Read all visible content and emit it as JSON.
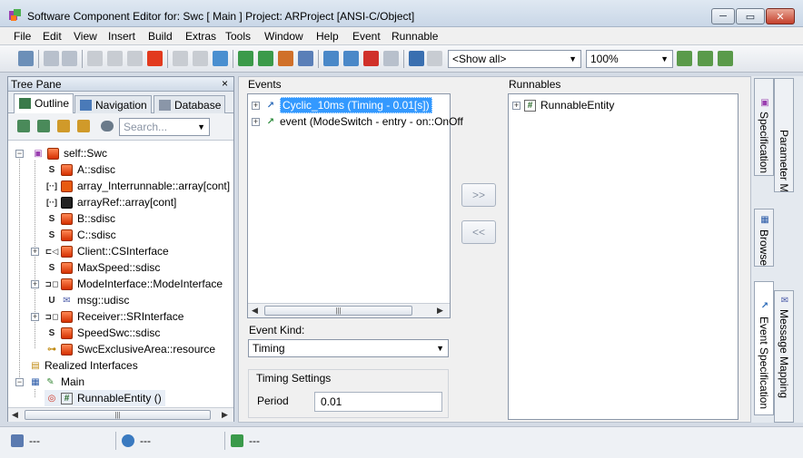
{
  "window": {
    "title": "Software Component Editor for: Swc [ Main ] Project: ARProject [ANSI-C/Object]",
    "min": "─",
    "max": "▭",
    "close": "✕"
  },
  "menu": [
    "File",
    "Edit",
    "View",
    "Insert",
    "Build",
    "Extras",
    "Tools",
    "Window",
    "Help",
    "Event",
    "Runnable"
  ],
  "toolbar": {
    "filter_combo": "<Show all>",
    "zoom_combo": "100%"
  },
  "tree_pane": {
    "title": "Tree Pane",
    "close": "×",
    "tabs": [
      "Outline",
      "Navigation",
      "Database"
    ],
    "search_placeholder": "Search...",
    "nodes": [
      {
        "label": "self::Swc",
        "glyph": "▣"
      },
      {
        "label": "A::sdisc",
        "glyph": "S"
      },
      {
        "label": "array_Interrunnable::array[cont]",
        "glyph": "[··]"
      },
      {
        "label": "arrayRef::array[cont]",
        "glyph": "[··]"
      },
      {
        "label": "B::sdisc",
        "glyph": "S"
      },
      {
        "label": "C::sdisc",
        "glyph": "S"
      },
      {
        "label": "Client::CSInterface",
        "glyph": "⊏◁"
      },
      {
        "label": "MaxSpeed::sdisc",
        "glyph": "S"
      },
      {
        "label": "ModeInterface::ModeInterface",
        "glyph": "⊐◻"
      },
      {
        "label": "msg::udisc",
        "glyph": "U"
      },
      {
        "label": "Receiver::SRInterface",
        "glyph": "⊐◻"
      },
      {
        "label": "SpeedSwc::sdisc",
        "glyph": "S"
      },
      {
        "label": "SwcExclusiveArea::resource",
        "glyph": "⊶"
      },
      {
        "label": "Realized Interfaces",
        "glyph": "▤"
      },
      {
        "label": "Main",
        "glyph": "▦"
      },
      {
        "label": "RunnableEntity ()",
        "glyph": "#"
      }
    ],
    "scroll_grip": "|||"
  },
  "events": {
    "label": "Events",
    "items": [
      "Cyclic_10ms (Timing - 0.01[s])",
      "event (ModeSwitch - entry - on::OnOff"
    ],
    "event_kind_label": "Event Kind:",
    "event_kind_value": "Timing",
    "timing_group": "Timing Settings",
    "period_label": "Period",
    "period_value": "0.01"
  },
  "buttons": {
    "add": ">>",
    "remove": "<<"
  },
  "runnables": {
    "label": "Runnables",
    "items": [
      "RunnableEntity"
    ]
  },
  "right_tabs": [
    "Specification",
    "Parameter Mapping",
    "Browse",
    "Message Mapping",
    "Event Specification"
  ],
  "status": [
    "---",
    "---",
    "---"
  ],
  "colors": {
    "selection": "#3399ff",
    "accent_red": "#d53000"
  }
}
